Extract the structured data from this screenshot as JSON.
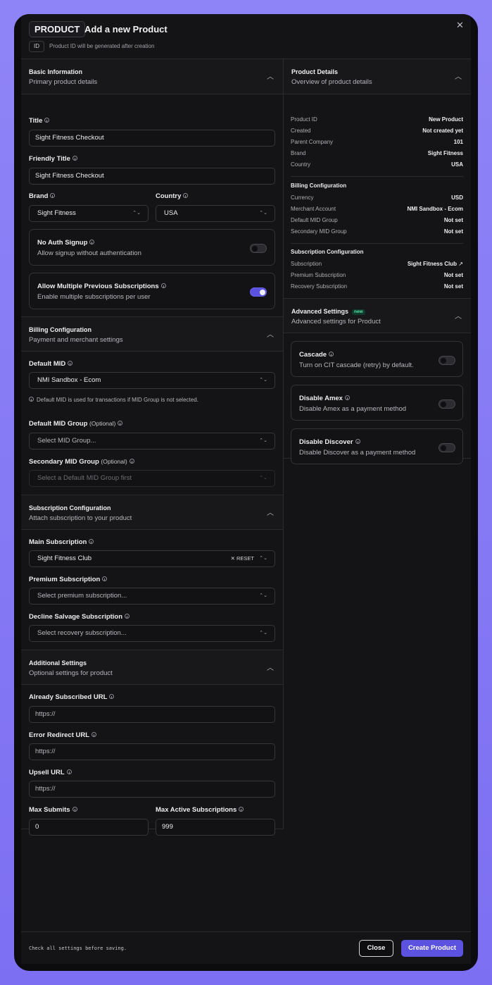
{
  "header": {
    "tag": "PRODUCT",
    "title": "Add a new Product",
    "id_tag": "ID",
    "id_note": "Product ID will be generated after creation"
  },
  "basic": {
    "title": "Basic Information",
    "subtitle": "Primary product details",
    "title_label": "Title",
    "title_value": "Sight Fitness Checkout",
    "friendly_label": "Friendly Title",
    "friendly_value": "Sight Fitness Checkout",
    "brand_label": "Brand",
    "brand_value": "Sight Fitness",
    "country_label": "Country",
    "country_value": "USA",
    "no_auth_title": "No Auth Signup",
    "no_auth_desc": "Allow signup without authentication",
    "no_auth_on": false,
    "multi_title": "Allow Multiple Previous Subscriptions",
    "multi_desc": "Enable multiple subscriptions per user",
    "multi_on": true
  },
  "billing": {
    "title": "Billing Configuration",
    "subtitle": "Payment and merchant settings",
    "default_mid_label": "Default MID",
    "default_mid_value": "NMI Sandbox - Ecom",
    "default_mid_note": "Default MID is used for transactions if MID Group is not selected.",
    "mid_group_label": "Default MID Group",
    "optional": "(Optional)",
    "mid_group_placeholder": "Select MID Group...",
    "secondary_label": "Secondary MID Group",
    "secondary_placeholder": "Select a Default MID Group first"
  },
  "subscription": {
    "title": "Subscription Configuration",
    "subtitle": "Attach subscription to your product",
    "main_label": "Main Subscription",
    "main_value": "Sight Fitness Club",
    "reset": "RESET",
    "premium_label": "Premium Subscription",
    "premium_placeholder": "Select premium subscription...",
    "decline_label": "Decline Salvage Subscription",
    "decline_placeholder": "Select recovery subscription..."
  },
  "additional": {
    "title": "Additional Settings",
    "subtitle": "Optional settings for product",
    "already_label": "Already Subscribed URL",
    "already_placeholder": "https://",
    "error_label": "Error Redirect URL",
    "error_placeholder": "https://",
    "upsell_label": "Upsell URL",
    "upsell_placeholder": "https://",
    "max_submits_label": "Max Submits",
    "max_submits_value": "0",
    "max_active_label": "Max Active Subscriptions",
    "max_active_value": "999"
  },
  "details": {
    "title": "Product Details",
    "subtitle": "Overview of product details",
    "rows": [
      {
        "k": "Product ID",
        "v": "New Product"
      },
      {
        "k": "Created",
        "v": "Not created yet"
      },
      {
        "k": "Parent Company",
        "v": "101"
      },
      {
        "k": "Brand",
        "v": "Sight Fitness"
      },
      {
        "k": "Country",
        "v": "USA"
      }
    ],
    "billing_heading": "Billing Configuration",
    "billing_rows": [
      {
        "k": "Currency",
        "v": "USD"
      },
      {
        "k": "Merchant Account",
        "v": "NMI Sandbox - Ecom"
      },
      {
        "k": "Default MID Group",
        "v": "Not set"
      },
      {
        "k": "Secondary MID Group",
        "v": "Not set"
      }
    ],
    "sub_heading": "Subscription Configuration",
    "sub_rows": [
      {
        "k": "Subscription",
        "v": "Sight Fitness Club"
      },
      {
        "k": "Premium Subscription",
        "v": "Not set"
      },
      {
        "k": "Recovery Subscription",
        "v": "Not set"
      }
    ]
  },
  "advanced": {
    "title": "Advanced Settings",
    "badge": "new",
    "subtitle": "Advanced settings for Product",
    "cards": [
      {
        "title": "Cascade",
        "desc": "Turn on CIT cascade (retry) by default.",
        "on": false
      },
      {
        "title": "Disable Amex",
        "desc": "Disable Amex as a payment method",
        "on": false
      },
      {
        "title": "Disable Discover",
        "desc": "Disable Discover as a payment method",
        "on": false
      }
    ]
  },
  "footer": {
    "note": "Check all settings before saving.",
    "close": "Close",
    "create": "Create Product"
  },
  "colors": {
    "accent": "#5b52e0",
    "background": "#8b7cf6",
    "panel": "#141416"
  }
}
